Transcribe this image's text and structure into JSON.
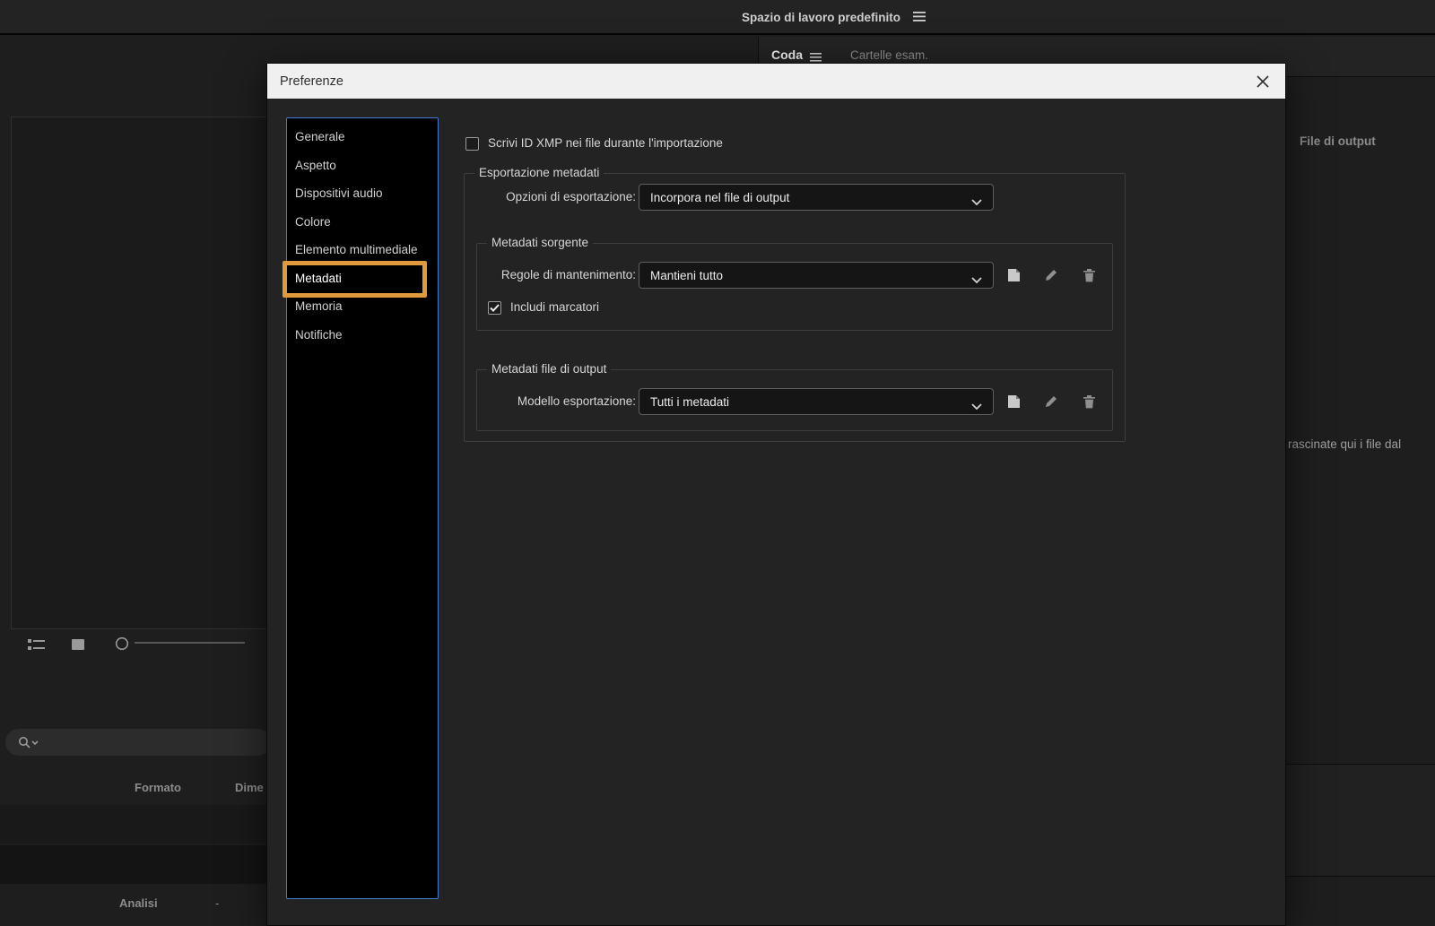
{
  "colors": {
    "annotation_orange": "#E19A3B",
    "sidebar_border_blue": "#3E7FD0",
    "dialog_titlebar": "#F0F0F0"
  },
  "topbar": {
    "workspace_label": "Spazio di lavoro predefinito"
  },
  "queue_panel": {
    "tab_queue": "Coda",
    "tab_watch_folders": "Cartelle esam.",
    "output_file_header": "File di output",
    "drop_hint_fragment": "rascinate qui i file dal"
  },
  "preset_panel": {
    "format_header": "Formato",
    "dimensions_header_fragment": "Dime",
    "analysis_label": "Analisi",
    "analysis_value": "-"
  },
  "dialog": {
    "title": "Preferenze",
    "selected_item": "Metadati",
    "sidebar_items": [
      {
        "label": "Generale"
      },
      {
        "label": "Aspetto"
      },
      {
        "label": "Dispositivi audio"
      },
      {
        "label": "Colore"
      },
      {
        "label": "Elemento multimediale"
      },
      {
        "label": "Metadati"
      },
      {
        "label": "Memoria"
      },
      {
        "label": "Notifiche"
      }
    ],
    "content": {
      "xmp_checkbox": {
        "label": "Scrivi ID XMP nei file durante l'importazione",
        "checked": false
      },
      "export_group": {
        "title": "Esportazione metadati",
        "export_options_label": "Opzioni di esportazione:",
        "export_options_value": "Incorpora nel file di output",
        "source_group": {
          "title": "Metadati sorgente",
          "retention_label": "Regole di mantenimento:",
          "retention_value": "Mantieni tutto",
          "include_markers": {
            "label": "Includi marcatori",
            "checked": true
          }
        },
        "output_group": {
          "title": "Metadati file di output",
          "template_label": "Modello esportazione:",
          "template_value": "Tutti i metadati"
        }
      }
    }
  }
}
